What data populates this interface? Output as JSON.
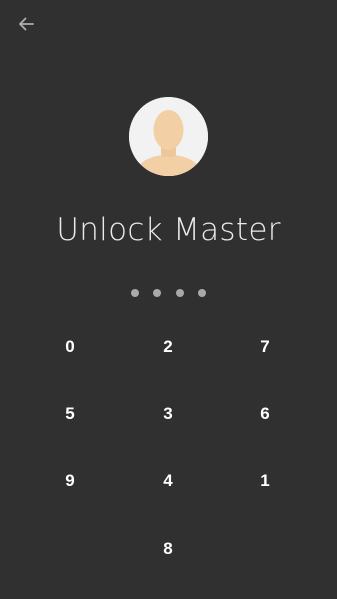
{
  "header": {
    "back_icon": "arrow-left-icon"
  },
  "profile": {
    "avatar_icon": "user-avatar-icon",
    "title": "Unlock Master"
  },
  "pin": {
    "dot_count": 4
  },
  "keypad": {
    "keys": [
      "0",
      "2",
      "7",
      "5",
      "3",
      "6",
      "9",
      "4",
      "1",
      "8"
    ]
  },
  "colors": {
    "background": "#303030",
    "text": "#EAEAEA",
    "dot": "#A9A9A9",
    "avatar_bg": "#F2F2F2",
    "skin": "#F2CFA5"
  }
}
